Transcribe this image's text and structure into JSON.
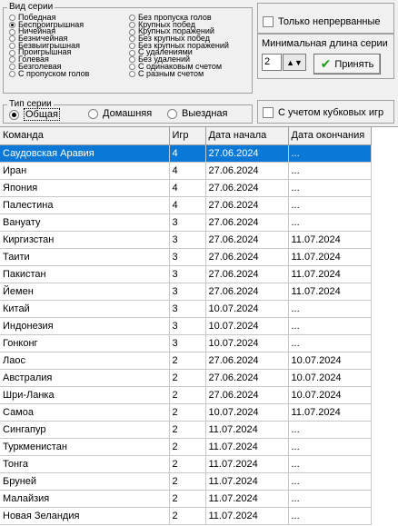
{
  "series_kind": {
    "legend": "Вид серии",
    "col1": [
      "Победная",
      "Беспроигрышная",
      "Ничейная",
      "Безничейная",
      "Безвыигрышная",
      "Проигрышная",
      "Голевая",
      "Безголевая",
      "С пропуском голов"
    ],
    "col2": [
      "Без пропуска голов",
      "Крупных побед",
      "Крупных поражений",
      "Без крупных побед",
      "Без крупных поражений",
      "С удалениями",
      "Без удалений",
      "С одинаковым счетом",
      "С разным счетом"
    ],
    "selected": "Беспроигрышная"
  },
  "continuous_only_label": "Только непрерванные",
  "min_length": {
    "label": "Минимальная длина серии",
    "value": "2"
  },
  "accept_label": "Принять",
  "series_type": {
    "legend": "Тип серии",
    "options": [
      "Общая",
      "Домашняя",
      "Выездная"
    ],
    "selected": "Общая"
  },
  "cups_label": "С учетом кубковых игр",
  "table": {
    "headers": [
      "Команда",
      "Игр",
      "Дата начала",
      "Дата окончания"
    ],
    "rows": [
      [
        "Саудовская Аравия",
        "4",
        "27.06.2024",
        "..."
      ],
      [
        "Иран",
        "4",
        "27.06.2024",
        "..."
      ],
      [
        "Япония",
        "4",
        "27.06.2024",
        "..."
      ],
      [
        "Палестина",
        "4",
        "27.06.2024",
        "..."
      ],
      [
        "Вануату",
        "3",
        "27.06.2024",
        "..."
      ],
      [
        "Киргизстан",
        "3",
        "27.06.2024",
        "11.07.2024"
      ],
      [
        "Таити",
        "3",
        "27.06.2024",
        "11.07.2024"
      ],
      [
        "Пакистан",
        "3",
        "27.06.2024",
        "11.07.2024"
      ],
      [
        "Йемен",
        "3",
        "27.06.2024",
        "11.07.2024"
      ],
      [
        "Китай",
        "3",
        "10.07.2024",
        "..."
      ],
      [
        "Индонезия",
        "3",
        "10.07.2024",
        "..."
      ],
      [
        "Гонконг",
        "3",
        "10.07.2024",
        "..."
      ],
      [
        "Лаос",
        "2",
        "27.06.2024",
        "10.07.2024"
      ],
      [
        "Австралия",
        "2",
        "27.06.2024",
        "10.07.2024"
      ],
      [
        "Шри-Ланка",
        "2",
        "27.06.2024",
        "10.07.2024"
      ],
      [
        "Самоа",
        "2",
        "10.07.2024",
        "11.07.2024"
      ],
      [
        "Сингапур",
        "2",
        "11.07.2024",
        "..."
      ],
      [
        "Туркменистан",
        "2",
        "11.07.2024",
        "..."
      ],
      [
        "Тонга",
        "2",
        "11.07.2024",
        "..."
      ],
      [
        "Бруней",
        "2",
        "11.07.2024",
        "..."
      ],
      [
        "Малайзия",
        "2",
        "11.07.2024",
        "..."
      ],
      [
        "Новая Зеландия",
        "2",
        "11.07.2024",
        "..."
      ]
    ],
    "selected_row": 0
  }
}
